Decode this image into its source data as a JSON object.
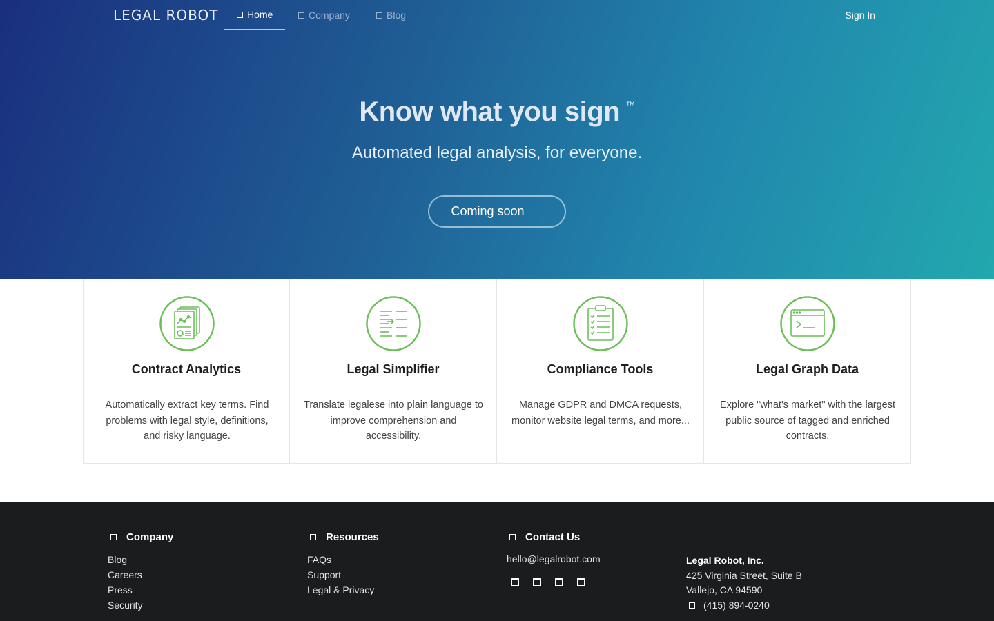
{
  "nav": {
    "logo": "LEGAL ROBOT",
    "tabs": [
      {
        "label": "Home",
        "icon": "square-icon",
        "active": true
      },
      {
        "label": "Company",
        "icon": "square-icon",
        "active": false
      },
      {
        "label": "Blog",
        "icon": "square-icon",
        "active": false
      }
    ],
    "sign_in": "Sign In"
  },
  "hero": {
    "title": "Know what you sign",
    "trademark": "™",
    "subtitle": "Automated legal analysis, for everyone.",
    "cta_label": "Coming soon"
  },
  "features": [
    {
      "title": "Contract Analytics",
      "description": "Automatically extract key terms. Find problems with legal style, definitions, and risky language.",
      "icon": "document-analytics-icon"
    },
    {
      "title": "Legal Simplifier",
      "description": "Translate legalese into plain language to improve comprehension and accessibility.",
      "icon": "text-simplify-icon"
    },
    {
      "title": "Compliance Tools",
      "description": "Manage GDPR and DMCA requests, monitor website legal terms, and more...",
      "icon": "checklist-clipboard-icon"
    },
    {
      "title": "Legal Graph Data",
      "description": "Explore \"what's market\" with the largest public source of tagged and enriched contracts.",
      "icon": "terminal-window-icon"
    }
  ],
  "footer": {
    "company": {
      "heading": "Company",
      "links": [
        "Blog",
        "Careers",
        "Press",
        "Security"
      ]
    },
    "resources": {
      "heading": "Resources",
      "links": [
        "FAQs",
        "Support",
        "Legal & Privacy"
      ]
    },
    "contact": {
      "heading": "Contact Us",
      "email": "hello@legalrobot.com"
    },
    "address": {
      "company": "Legal Robot, Inc.",
      "street": "425 Virginia Street, Suite B",
      "city": "Vallejo, CA 94590",
      "phone": "(415) 894-0240"
    }
  },
  "colors": {
    "accent_green": "#6cbf5a",
    "footer_bg": "#1b1c1d"
  }
}
